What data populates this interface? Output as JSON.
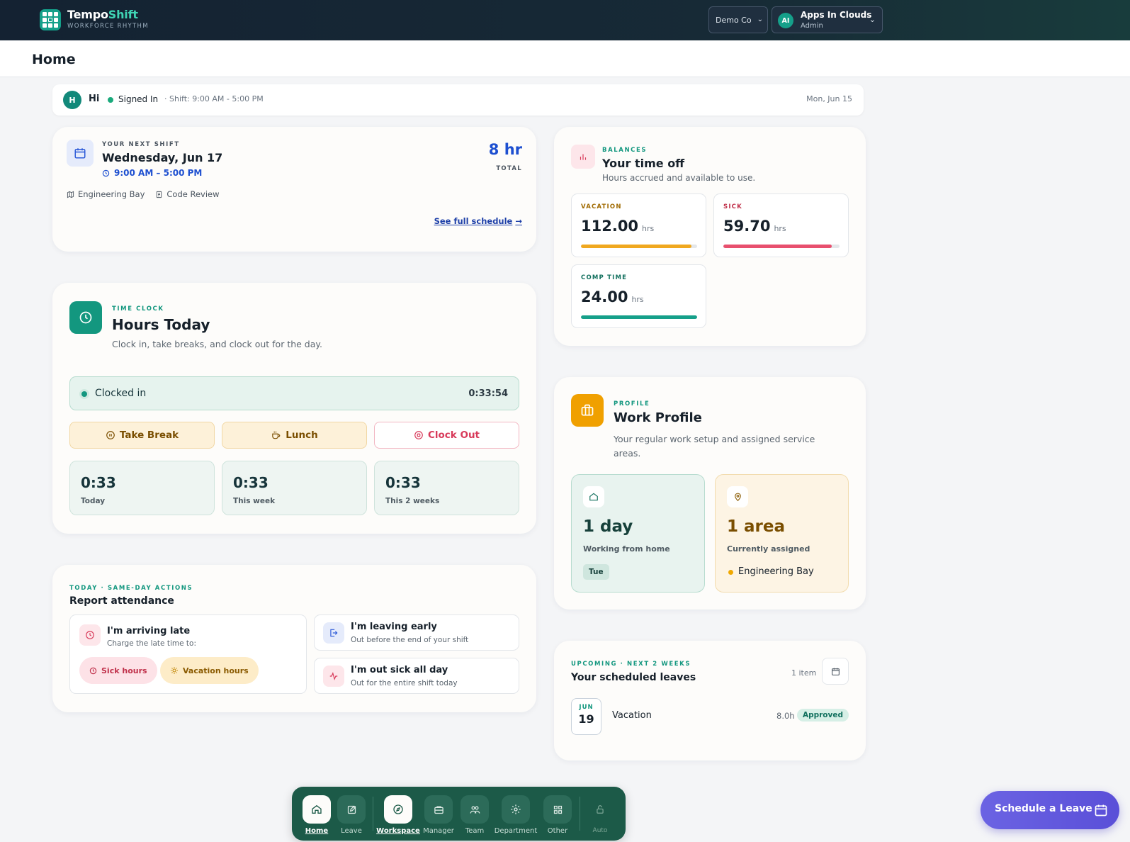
{
  "header": {
    "brand_a": "Tempo",
    "brand_b": "Shift",
    "tagline": "WORKFORCE RHYTHM",
    "company": "Demo Co",
    "user_initials": "AI",
    "user_name": "Apps In Clouds",
    "user_role": "Admin"
  },
  "page": {
    "title": "Home"
  },
  "status": {
    "initial": "H",
    "greeting": "Hi",
    "state": "Signed In",
    "sep": "·",
    "shift": "Shift: 9:00 AM - 5:00 PM",
    "date": "Mon, Jun 15"
  },
  "next_shift": {
    "eyebrow": "YOUR NEXT SHIFT",
    "day": "Wednesday, Jun 17",
    "time": "9:00 AM – 5:00 PM",
    "total": "8 hr",
    "total_label": "TOTAL",
    "location": "Engineering Bay",
    "task": "Code Review",
    "link": "See full schedule"
  },
  "time_clock": {
    "eyebrow": "TIME CLOCK",
    "title": "Hours Today",
    "subtitle": "Clock in, take breaks, and clock out for the day.",
    "state": "Clocked in",
    "elapsed": "0:33:54",
    "break_label": "Take Break",
    "lunch_label": "Lunch",
    "clockout_label": "Clock Out",
    "stats": [
      {
        "value": "0:33",
        "label": "Today"
      },
      {
        "value": "0:33",
        "label": "This week"
      },
      {
        "value": "0:33",
        "label": "This 2 weeks"
      }
    ]
  },
  "attendance": {
    "eyebrow": "TODAY · SAME-DAY ACTIONS",
    "title": "Report attendance",
    "late_title": "I'm arriving late",
    "late_sub": "Charge the late time to:",
    "sick_hours": "Sick hours",
    "vacation_hours": "Vacation hours",
    "early_title": "I'm leaving early",
    "early_sub": "Out before the end of your shift",
    "sickday_title": "I'm out sick all day",
    "sickday_sub": "Out for the entire shift today"
  },
  "balances": {
    "eyebrow": "BALANCES",
    "title": "Your time off",
    "subtitle": "Hours accrued and available to use.",
    "unit": "hrs",
    "items": [
      {
        "label": "VACATION",
        "value": "112.00",
        "fill": 0.95,
        "color": "#f0a820",
        "label_color": "#a06a00"
      },
      {
        "label": "SICK",
        "value": "59.70",
        "fill": 0.93,
        "color": "#e8506e",
        "label_color": "#c0304a"
      },
      {
        "label": "COMP TIME",
        "value": "24.00",
        "fill": 1.0,
        "color": "#16a08a",
        "label_color": "#12705e"
      }
    ]
  },
  "profile": {
    "eyebrow": "PROFILE",
    "title": "Work Profile",
    "subtitle": "Your regular work setup and assigned service areas.",
    "wfh_value": "1 day",
    "wfh_label": "Working from home",
    "wfh_day": "Tue",
    "area_value": "1 area",
    "area_label": "Currently assigned",
    "area_name": "Engineering Bay"
  },
  "leaves": {
    "eyebrow": "UPCOMING · NEXT 2 WEEKS",
    "title": "Your scheduled leaves",
    "count": "1 item",
    "items": [
      {
        "month": "JUN",
        "day": "19",
        "type": "Vacation",
        "hours": "8.0h",
        "status": "Approved"
      }
    ]
  },
  "nav": {
    "home": "Home",
    "leave": "Leave",
    "workspace": "Workspace",
    "manager": "Manager",
    "team": "Team",
    "department": "Department",
    "other": "Other",
    "auto": "Auto"
  },
  "fab": {
    "label": "Schedule a Leave"
  },
  "colors": {
    "brand": "#15a08a",
    "nav": "#1c5a48",
    "accent": "#5a4fd8",
    "blue": "#1d4fd0"
  }
}
